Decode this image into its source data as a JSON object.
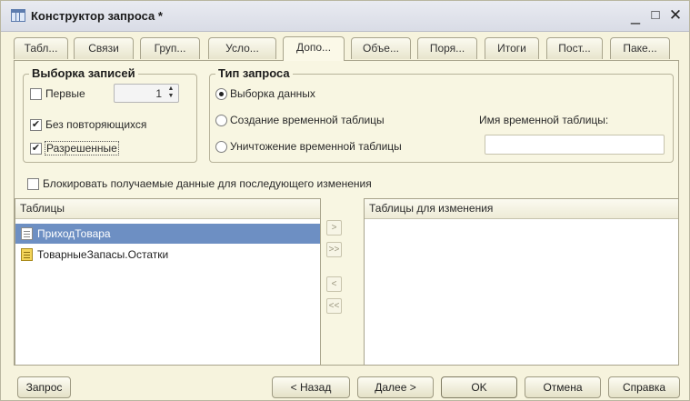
{
  "window": {
    "title": "Конструктор запроса *",
    "minimize_glyph": "_",
    "maximize_glyph": "□",
    "close_glyph": "✕"
  },
  "tabs": [
    {
      "label": "Табл..."
    },
    {
      "label": "Связи"
    },
    {
      "label": "Груп..."
    },
    {
      "label": "Усло..."
    },
    {
      "label": "Допо..."
    },
    {
      "label": "Объе..."
    },
    {
      "label": "Поря..."
    },
    {
      "label": "Итоги"
    },
    {
      "label": "Пост..."
    },
    {
      "label": "Паке..."
    }
  ],
  "active_tab": "Допо...",
  "selection_group": {
    "title": "Выборка записей",
    "first": {
      "label": "Первые",
      "checked": false,
      "value": "1"
    },
    "distinct": {
      "label": "Без повторяющихся",
      "checked": true
    },
    "allowed": {
      "label": "Разрешенные",
      "checked": true
    }
  },
  "query_type_group": {
    "title": "Тип запроса",
    "options": [
      {
        "label": "Выборка данных",
        "selected": true
      },
      {
        "label": "Создание временной таблицы",
        "selected": false
      },
      {
        "label": "Уничтожение временной таблицы",
        "selected": false
      }
    ],
    "temp_table_label": "Имя временной таблицы:",
    "temp_table_value": ""
  },
  "lock": {
    "label": "Блокировать получаемые данные для последующего изменения",
    "checked": false
  },
  "tables_list": {
    "header": "Таблицы",
    "items": [
      {
        "label": "ПриходТовара",
        "icon": "document-icon",
        "selected": true
      },
      {
        "label": "ТоварныеЗапасы.Остатки",
        "icon": "register-icon",
        "selected": false
      }
    ]
  },
  "tables_for_change": {
    "header": "Таблицы для изменения",
    "items": []
  },
  "mover_buttons": [
    ">",
    ">>",
    "<",
    "<<"
  ],
  "buttons": {
    "query": "Запрос",
    "back": "< Назад",
    "next": "Далее >",
    "ok": "OK",
    "cancel": "Отмена",
    "help": "Справка"
  },
  "colors": {
    "window_bg": "#f6f3dd",
    "selection": "#6d8fc3"
  }
}
